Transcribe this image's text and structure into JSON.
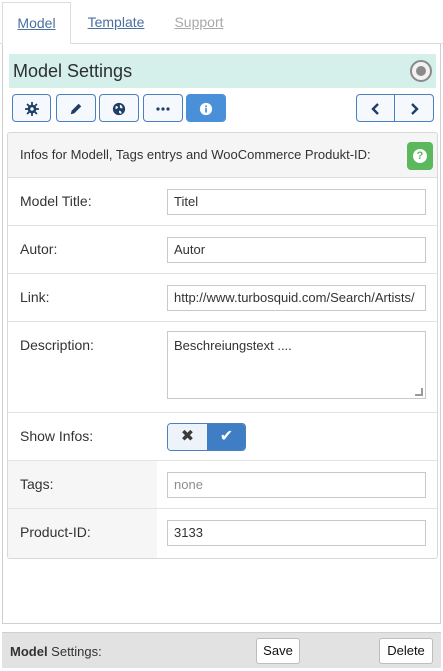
{
  "tabs": [
    {
      "label": "Model",
      "active": true
    },
    {
      "label": "Template",
      "active": false
    },
    {
      "label": "Support",
      "active": false
    }
  ],
  "panel": {
    "title": "Model Settings",
    "toolbar": {
      "buttons": [
        {
          "icon": "gear-icon",
          "active": false
        },
        {
          "icon": "pencil-icon",
          "active": false
        },
        {
          "icon": "globe-icon",
          "active": false
        },
        {
          "icon": "more-icon",
          "active": false
        },
        {
          "icon": "info-icon",
          "active": true
        }
      ],
      "nav": [
        "chevron-left-icon",
        "chevron-right-icon"
      ]
    },
    "info": {
      "text": "Infos for Modell, Tags entrys and WooCommerce Produkt-ID:",
      "help": "?"
    },
    "fields": {
      "model_title": {
        "label": "Model Title:",
        "value": "Titel"
      },
      "autor": {
        "label": "Autor:",
        "value": "Autor"
      },
      "link": {
        "label": "Link:",
        "value": "http://www.turbosquid.com/Search/Artists/"
      },
      "description": {
        "label": "Description:",
        "value": "Beschreiungstext ...."
      },
      "show_infos": {
        "label": "Show Infos:",
        "off_symbol": "✖",
        "on_symbol": "✔",
        "value": true
      },
      "tags": {
        "label": "Tags:",
        "placeholder": "none",
        "value": ""
      },
      "product_id": {
        "label": "Product-ID:",
        "value": "3133"
      }
    }
  },
  "footer": {
    "label_bold": "Model",
    "label_rest": " Settings:",
    "save": "Save",
    "delete": "Delete"
  },
  "colors": {
    "header_bg": "#d5efeb",
    "primary": "#4a90d9",
    "help_green": "#5cb85c",
    "link_blue": "#4a6fa0"
  }
}
